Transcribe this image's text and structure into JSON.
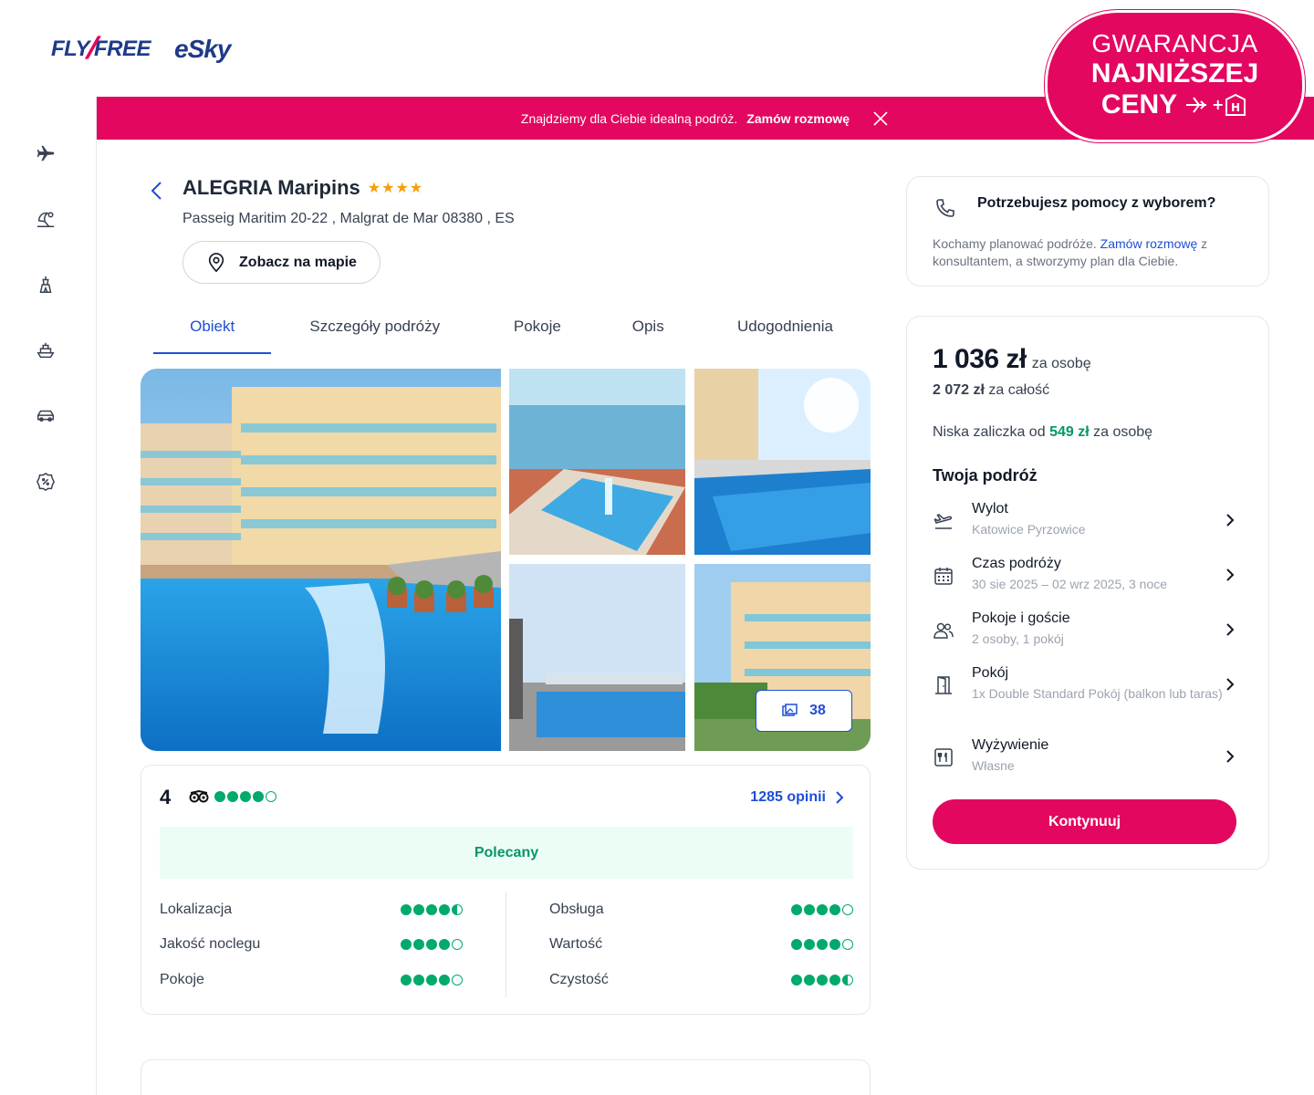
{
  "header": {
    "logo_flyfree_left": "FLY",
    "logo_flyfree_right": "FREE",
    "logo_esky": "eSky"
  },
  "guarantee": {
    "line1": "GWARANCJA",
    "line2": "NAJNIŻSZEJ",
    "line3": "CENY",
    "plus": "+",
    "hotel_letter": "H"
  },
  "promo_bar": {
    "text": "Znajdziemy dla Ciebie idealną podróż.",
    "link": "Zamów rozmowę"
  },
  "sidebar": {
    "items": [
      {
        "icon": "airplane-icon"
      },
      {
        "icon": "beach-umbrella-icon"
      },
      {
        "icon": "landmark-icon"
      },
      {
        "icon": "ship-icon"
      },
      {
        "icon": "car-icon"
      },
      {
        "icon": "discount-icon"
      }
    ]
  },
  "hotel": {
    "name": "ALEGRIA Maripins",
    "stars": "★★★★",
    "address": "Passeig Maritim 20-22 , Malgrat de Mar 08380 , ES",
    "map_button": "Zobacz na mapie"
  },
  "tabs": [
    {
      "label": "Obiekt",
      "active": true
    },
    {
      "label": "Szczegóły podróży",
      "active": false
    },
    {
      "label": "Pokoje",
      "active": false
    },
    {
      "label": "Opis",
      "active": false
    },
    {
      "label": "Udogodnienia",
      "active": false
    }
  ],
  "gallery": {
    "photo_count": "38"
  },
  "reviews": {
    "score": "4",
    "rating_value": 4,
    "rating_max": 5,
    "count_link": "1285 opinii",
    "recommended": "Polecany",
    "categories": [
      {
        "label": "Lokalizacja",
        "rating": 4.5
      },
      {
        "label": "Jakość noclegu",
        "rating": 4
      },
      {
        "label": "Pokoje",
        "rating": 4
      },
      {
        "label": "Obsługa",
        "rating": 4
      },
      {
        "label": "Wartość",
        "rating": 4
      },
      {
        "label": "Czystość",
        "rating": 4.5
      }
    ]
  },
  "help": {
    "title": "Potrzebujesz pomocy z wyborem?",
    "text_before": "Kochamy planować podróże.",
    "link": "Zamów rozmowę",
    "text_after": "z konsultantem, a stworzymy plan dla Ciebie."
  },
  "price": {
    "per_person": "1 036 zł",
    "per_person_label": "za osobę",
    "total": "2 072 zł",
    "total_label": "za całość",
    "deposit_before": "Niska zaliczka od",
    "deposit_amount": "549 zł",
    "deposit_after": "za osobę",
    "trip_title": "Twoja podróż",
    "trip_items": [
      {
        "icon": "departure-icon",
        "label": "Wylot",
        "value": "Katowice Pyrzowice"
      },
      {
        "icon": "calendar-icon",
        "label": "Czas podróży",
        "value": "30 sie 2025 – 02 wrz 2025, 3 noce"
      },
      {
        "icon": "guests-icon",
        "label": "Pokoje i goście",
        "value": "2 osoby, 1 pokój"
      },
      {
        "icon": "door-icon",
        "label": "Pokój",
        "value": "1x Double Standard Pokój (balkon lub taras)"
      },
      {
        "icon": "meal-icon",
        "label": "Wyżywienie",
        "value": "Własne"
      }
    ],
    "continue_button": "Kontynuuj"
  },
  "colors": {
    "brand_pink": "#e3075f",
    "link_blue": "#1d4ed8",
    "rating_green": "#00aa6c"
  }
}
